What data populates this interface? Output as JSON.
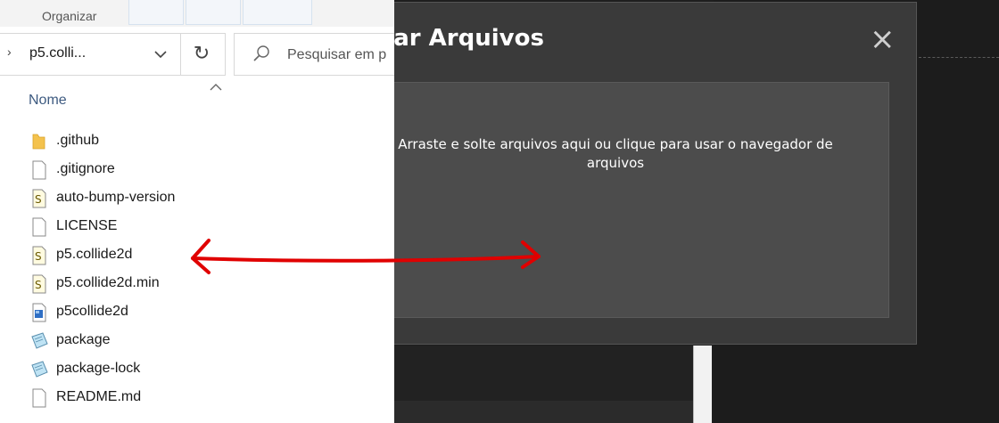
{
  "ribbon": {
    "organize_label": "Organizar"
  },
  "address": {
    "chevron": "›",
    "path": "p5.colli..."
  },
  "search": {
    "placeholder": "Pesquisar em p"
  },
  "columns": {
    "name": "Nome"
  },
  "files": [
    {
      "name": ".github",
      "icon": "folder-icon"
    },
    {
      "name": ".gitignore",
      "icon": "file-icon"
    },
    {
      "name": "auto-bump-version",
      "icon": "script-file-icon"
    },
    {
      "name": "LICENSE",
      "icon": "file-icon"
    },
    {
      "name": "p5.collide2d",
      "icon": "script-file-icon"
    },
    {
      "name": "p5.collide2d.min",
      "icon": "script-file-icon"
    },
    {
      "name": "p5collide2d",
      "icon": "image-file-icon"
    },
    {
      "name": "package",
      "icon": "json-file-icon"
    },
    {
      "name": "package-lock",
      "icon": "json-file-icon"
    },
    {
      "name": "README.md",
      "icon": "file-icon"
    }
  ],
  "modal": {
    "title": "egar Arquivos",
    "close": "×",
    "dropzone_text": "Arraste e solte arquivos aqui ou clique para usar o navegador de arquivos"
  },
  "colors": {
    "annotation": "#e00000",
    "modal_bg": "#3a3a3a",
    "dropzone_bg": "#4c4c4c"
  }
}
